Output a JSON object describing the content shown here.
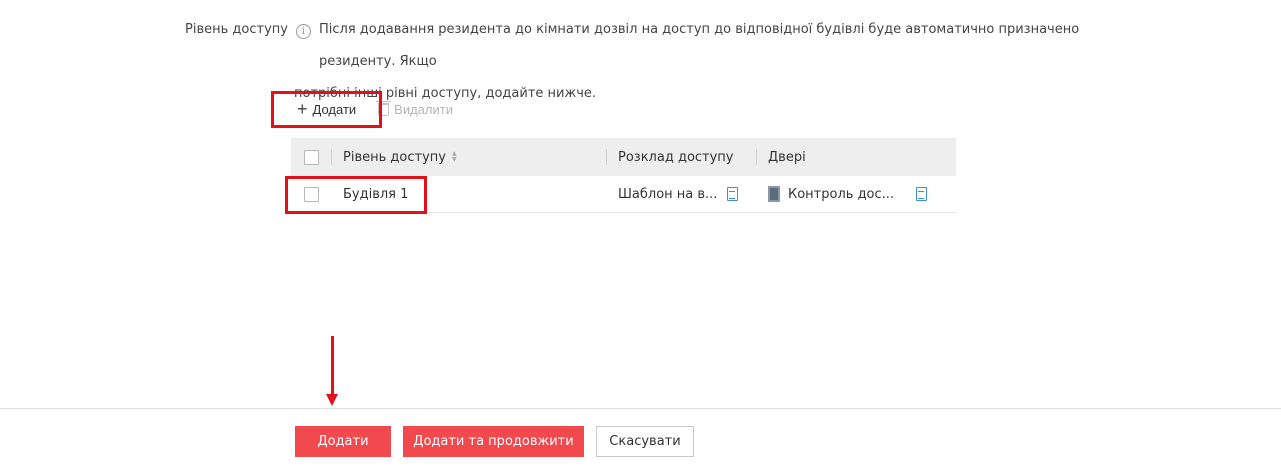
{
  "access_level": {
    "label": "Рівень доступу",
    "info_line1": "Після додавання резидента до кімнати дозвіл на доступ до відповідної будівлі буде автоматично призначено резиденту. Якщо",
    "info_line2": "потрібні інші рівні доступу, додайте нижче."
  },
  "toolbar": {
    "add_label": "Додати",
    "delete_label": "Видалити"
  },
  "table": {
    "columns": [
      "Рівень доступу",
      "Розклад доступу",
      "Двері"
    ],
    "rows": [
      {
        "level": "Будівля 1",
        "schedule": "Шаблон на в...",
        "door": "Контроль дос..."
      }
    ]
  },
  "footer": {
    "add_label": "Додати",
    "add_continue_label": "Додати та продовжити",
    "cancel_label": "Скасувати"
  },
  "colors": {
    "primary": "#f2494f",
    "highlight": "#e3101a",
    "link_icon": "#3e8fd0"
  }
}
